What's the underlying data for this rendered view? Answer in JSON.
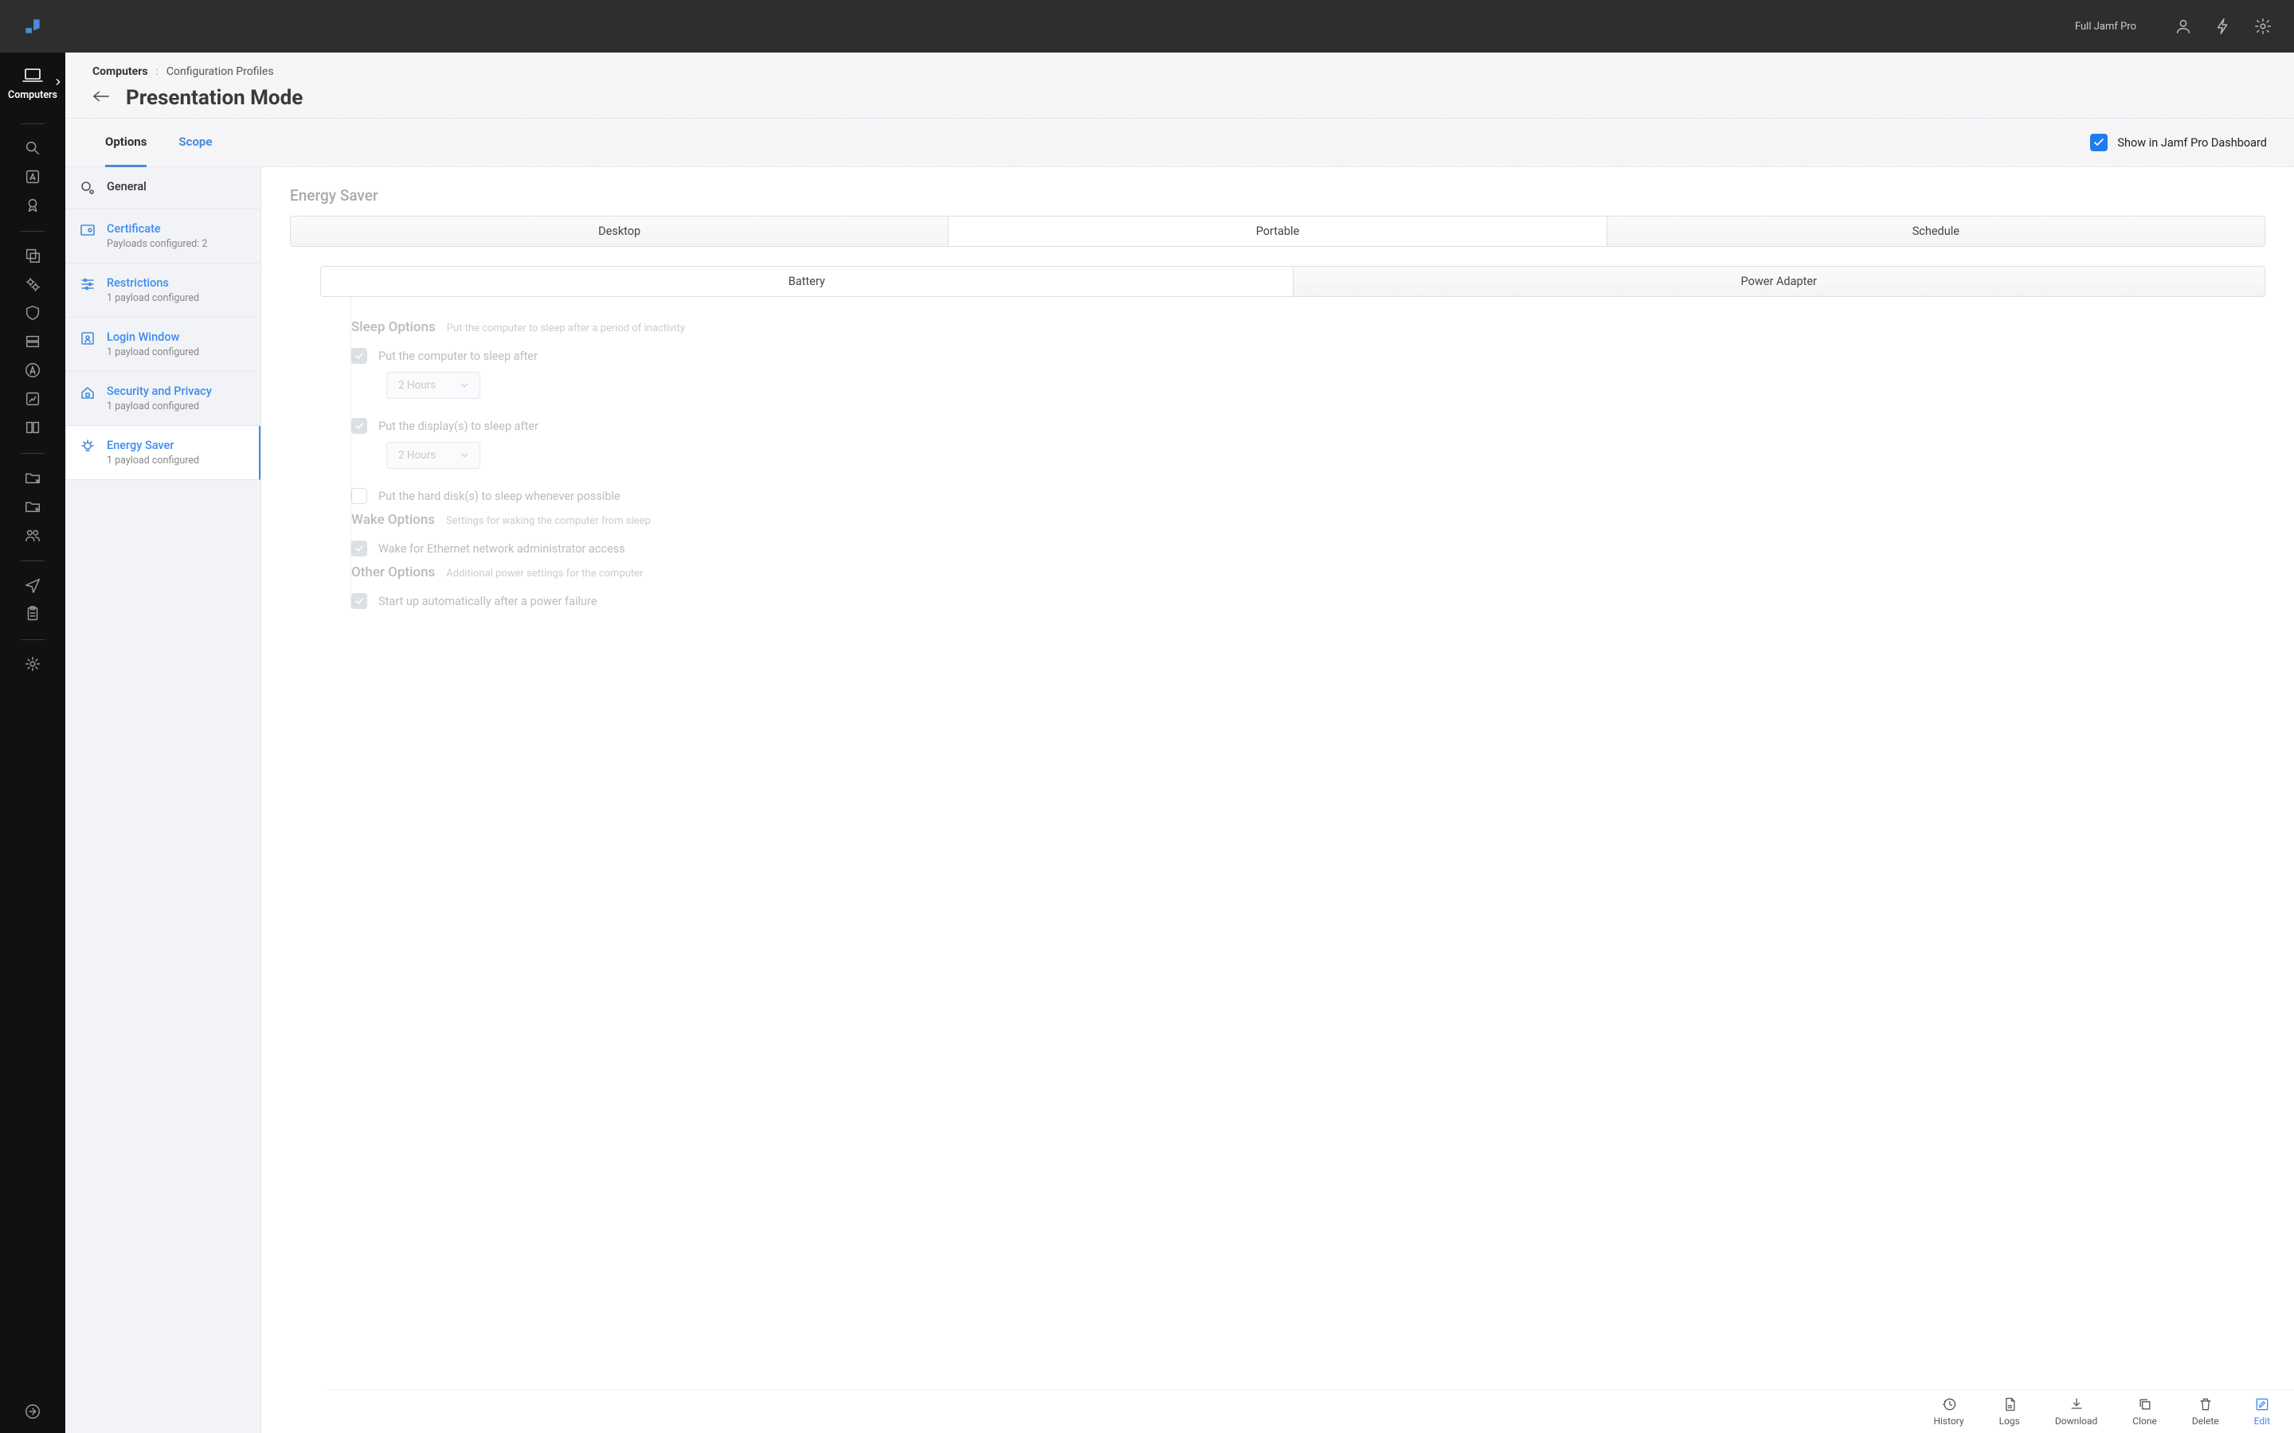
{
  "topbar": {
    "tenant": "Full Jamf Pro"
  },
  "rail": {
    "selected_label": "Computers"
  },
  "breadcrumb": {
    "root": "Computers",
    "leaf": "Configuration Profiles"
  },
  "page_title": "Presentation Mode",
  "subtabs": {
    "options": "Options",
    "scope": "Scope"
  },
  "dashboard_toggle_label": "Show in Jamf Pro Dashboard",
  "payloads": {
    "general": {
      "name": "General"
    },
    "certificate": {
      "name": "Certificate",
      "sub": "Payloads configured: 2"
    },
    "restrictions": {
      "name": "Restrictions",
      "sub": "1 payload configured"
    },
    "login_window": {
      "name": "Login Window",
      "sub": "1 payload configured"
    },
    "security_privacy": {
      "name": "Security and Privacy",
      "sub": "1 payload configured"
    },
    "energy_saver": {
      "name": "Energy Saver",
      "sub": "1 payload configured"
    }
  },
  "panel_title": "Energy Saver",
  "seg_top": {
    "desktop": "Desktop",
    "portable": "Portable",
    "schedule": "Schedule"
  },
  "seg_sub": {
    "battery": "Battery",
    "power_adapter": "Power Adapter"
  },
  "sections": {
    "sleep": {
      "title": "Sleep Options",
      "desc": "Put the computer to sleep after a period of inactivity"
    },
    "wake": {
      "title": "Wake Options",
      "desc": "Settings for waking the computer from sleep"
    },
    "other": {
      "title": "Other Options",
      "desc": "Additional power settings for the computer"
    }
  },
  "opts": {
    "sleep_computer": "Put the computer to sleep after",
    "sleep_display": "Put the display(s) to sleep after",
    "sleep_hd": "Put the hard disk(s) to sleep whenever possible",
    "wake_eth": "Wake for Ethernet network administrator access",
    "auto_start": "Start up automatically after a power failure",
    "duration": "2 Hours"
  },
  "footer": {
    "history": "History",
    "logs": "Logs",
    "download": "Download",
    "clone": "Clone",
    "delete": "Delete",
    "edit": "Edit"
  }
}
